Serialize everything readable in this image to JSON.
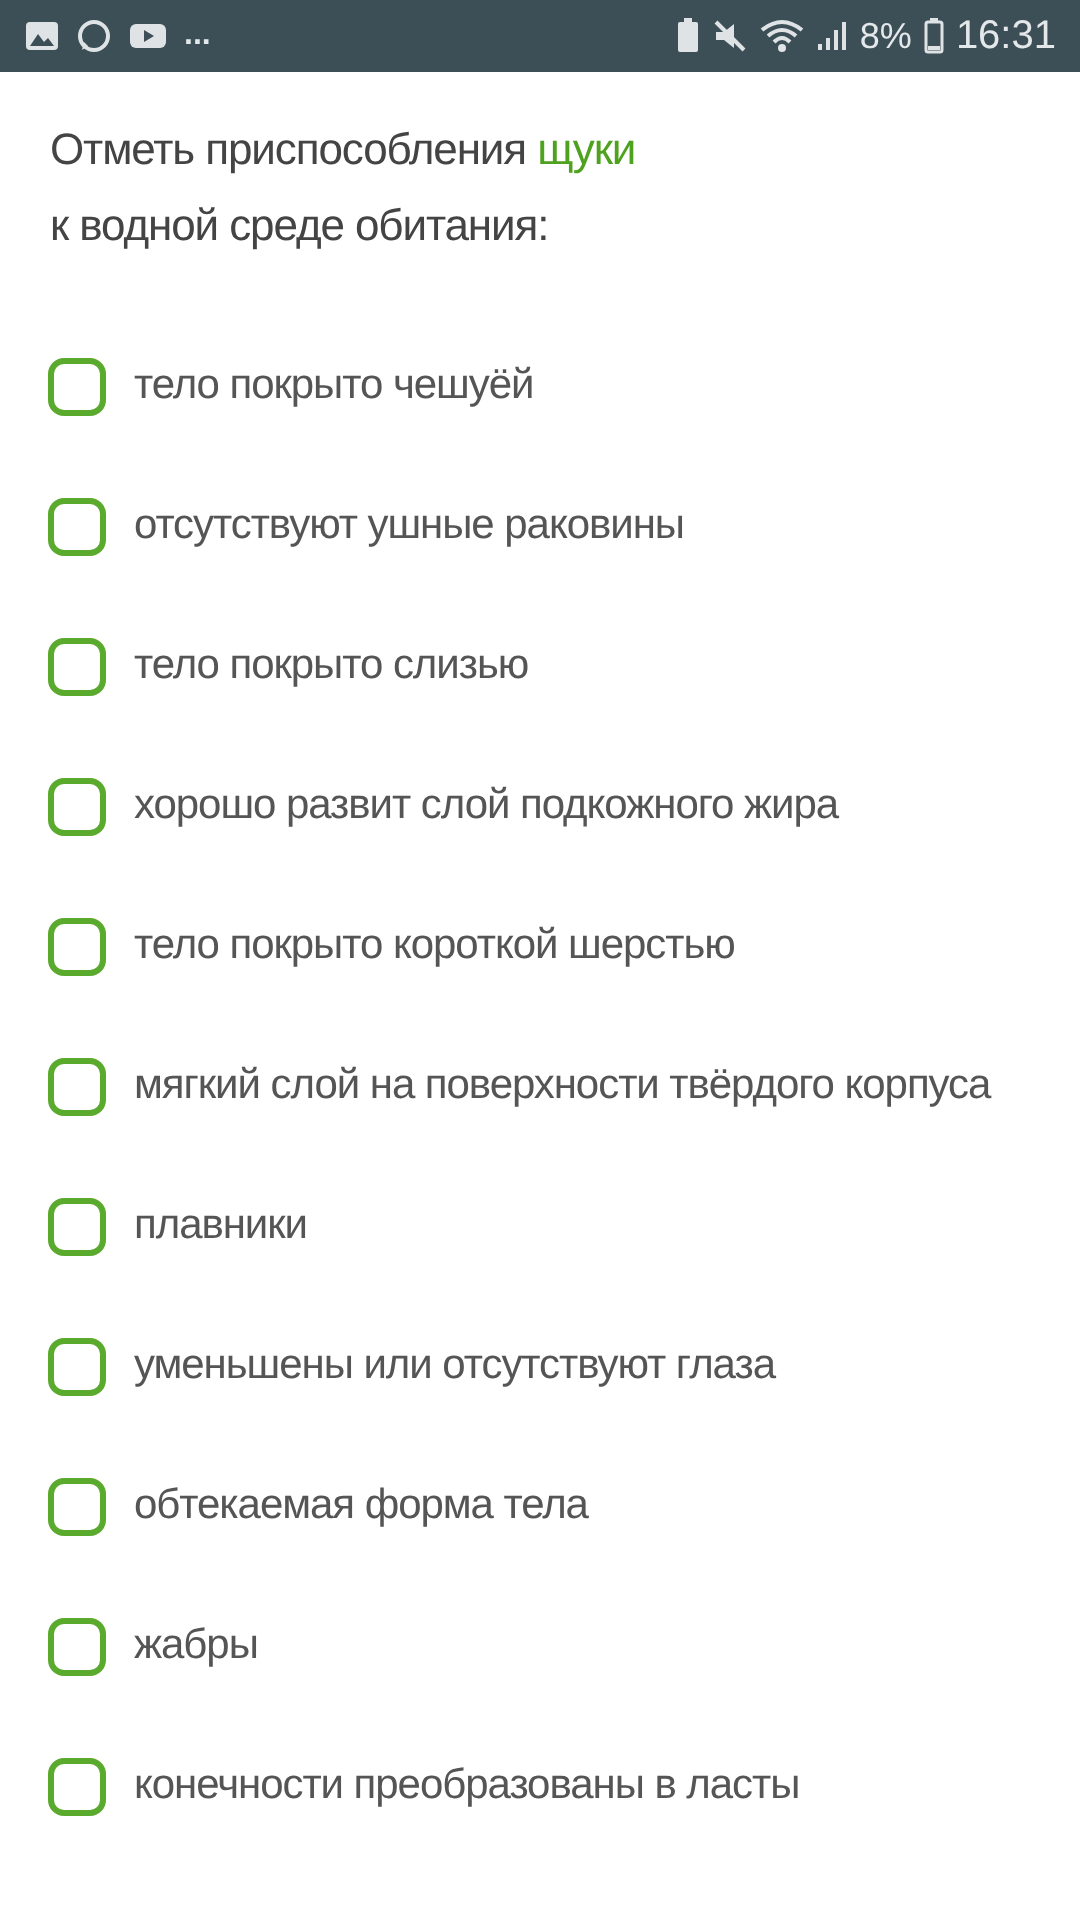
{
  "status_bar": {
    "more": "...",
    "battery_percent": "8%",
    "time": "16:31"
  },
  "question": {
    "lines": [
      [
        {
          "text": "Отметь приспособления ",
          "highlight": false
        },
        {
          "text": "щуки",
          "highlight": true
        }
      ],
      [
        {
          "text": "к водной среде обитания:",
          "highlight": false
        }
      ]
    ]
  },
  "options": [
    {
      "label": "тело покрыто чешуёй",
      "checked": false
    },
    {
      "label": "отсутствуют ушные раковины",
      "checked": false
    },
    {
      "label": "тело покрыто слизью",
      "checked": false
    },
    {
      "label": "хорошо развит слой подкожного жира",
      "checked": false
    },
    {
      "label": "тело покрыто короткой шерстью",
      "checked": false
    },
    {
      "label": "мягкий слой на поверхности твёрдого корпуса",
      "checked": false
    },
    {
      "label": "плавники",
      "checked": false
    },
    {
      "label": "уменьшены или отсутствуют глаза",
      "checked": false
    },
    {
      "label": "обтекаемая форма тела",
      "checked": false
    },
    {
      "label": "жабры",
      "checked": false
    },
    {
      "label": "конечности преобразованы в ласты",
      "checked": false
    }
  ]
}
